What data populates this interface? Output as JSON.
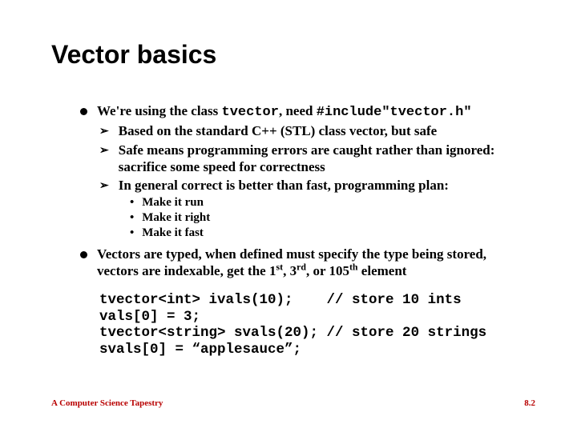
{
  "title": "Vector basics",
  "points": {
    "p1": {
      "prefix": "We're using the class ",
      "code1": "tvector",
      "mid": ", need ",
      "code2": "#include\"tvector.h\"",
      "sub": [
        "Based on the standard C++ (STL) class vector, but safe",
        "Safe means programming errors are caught rather than ignored: sacrifice some speed for correctness",
        "In general correct is better than fast, programming plan:"
      ],
      "subsub": [
        "Make it run",
        "Make it right",
        "Make it fast"
      ]
    },
    "p2": {
      "prefix": "Vectors are typed, when defined must specify the type being stored, vectors are indexable, get the 1",
      "sup1": "st",
      "mid1": ", 3",
      "sup2": "rd",
      "mid2": ", or 105",
      "sup3": "th",
      "suffix": " element"
    }
  },
  "code": "tvector<int> ivals(10);    // store 10 ints\nvals[0] = 3;\ntvector<string> svals(20); // store 20 strings\nsvals[0] = “applesauce”;",
  "footer": {
    "left": "A Computer Science Tapestry",
    "right": "8.2"
  }
}
